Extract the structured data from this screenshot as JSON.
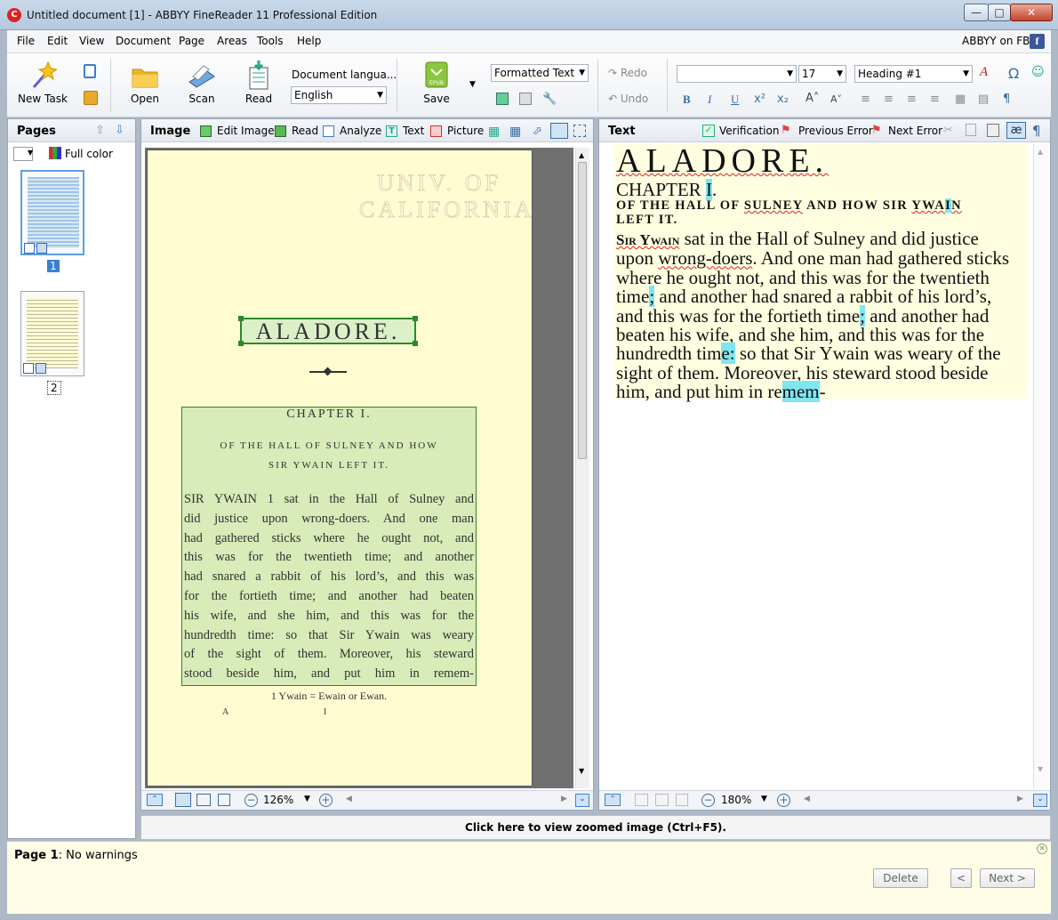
{
  "window": {
    "title": "Untitled document [1] - ABBYY FineReader 11 Professional Edition"
  },
  "menu": {
    "items": [
      "File",
      "Edit",
      "View",
      "Document",
      "Page",
      "Areas",
      "Tools",
      "Help"
    ],
    "abbyy_fb": "ABBYY on FB:"
  },
  "toolbar": {
    "new_task": "New Task",
    "open": "Open",
    "scan": "Scan",
    "read": "Read",
    "doc_lang_label": "Document langua...",
    "doc_lang_value": "English",
    "save": "Save",
    "epub": "EPUB",
    "format_mode": "Formatted Text",
    "redo": "Redo",
    "undo": "Undo",
    "font_size": "17",
    "style": "Heading #1",
    "bold": "B",
    "italic": "I",
    "underline": "U"
  },
  "pages_panel": {
    "title": "Pages",
    "color_mode": "Full color",
    "thumbs": [
      {
        "number": "1"
      },
      {
        "number": "2"
      }
    ]
  },
  "image_pane": {
    "title": "Image",
    "tools": [
      "Edit Image",
      "Read",
      "Analyze",
      "Text",
      "Picture"
    ],
    "zoom": "126%",
    "page": {
      "stamp": "UNIV. OF\nCALIFORNIA",
      "title": "ALADORE.",
      "chapter": "CHAPTER I.",
      "subtitle_1": "OF THE HALL OF SULNEY AND HOW",
      "subtitle_2": "SIR YWAIN LEFT IT.",
      "lines": [
        "SIR YWAIN 1 sat in the Hall of Sulney and",
        "did justice upon wrong-doers.  And one man",
        "had gathered sticks where he ought not, and",
        "this was for the twentieth time; and another",
        "had snared a rabbit of his lord’s, and this was",
        "for the fortieth time; and another had beaten",
        "his wife, and she him, and this was for the",
        "hundredth time: so that Sir Ywain was weary",
        "of the sight of them.  Moreover, his steward",
        "stood beside him, and put him in remem-"
      ],
      "footnote": "1 Ywain = Ewain or Ewan.",
      "sig_a": "A",
      "sig_i": "I"
    }
  },
  "text_pane": {
    "title": "Text",
    "verification": "Verification",
    "prev_error": "Previous Error",
    "next_error": "Next Error",
    "zoom": "180%",
    "content": {
      "title": "ALADORE.",
      "chapter_a": "CHAPTER ",
      "chapter_b": "I",
      "chapter_c": ".",
      "sub_a": "OF THE HALL OF ",
      "sub_b": "SULNEY",
      "sub_c": " AND HOW SIR ",
      "sub_d": "YWA",
      "sub_e": "I",
      "sub_f": "N",
      "sub_g": "LEFT IT.",
      "l1a": "Sir Ywain",
      "l1b": " sat in the Hall of Sulney and did justice",
      "l2a": "upon ",
      "l2b": "wrong-doers",
      "l2c": ". And one man had gathered sticks",
      "l3": "where he ought not, and this was for the twentieth",
      "l4a": "time",
      "l4b": ";",
      "l4c": " and another had snared a rabbit of his lord’s,",
      "l5a": "and this was for the fortieth time",
      "l5b": ";",
      "l5c": " and another had",
      "l6": "beaten his wife, and she him, and this was for the",
      "l7a": "hundredth tim",
      "l7b": "e:",
      "l7c": " so that Sir Ywain was weary of the",
      "l8": "sight of them. Moreover, his steward stood beside",
      "l9a": "him, and put him in re",
      "l9b": "mem",
      "l9c": "-"
    }
  },
  "zoom_bar": {
    "label": "Click here to view zoomed image (Ctrl+F5)."
  },
  "status": {
    "page": "Page 1",
    "msg": ": No warnings",
    "delete": "Delete",
    "prev": "<",
    "next": "Next >"
  }
}
